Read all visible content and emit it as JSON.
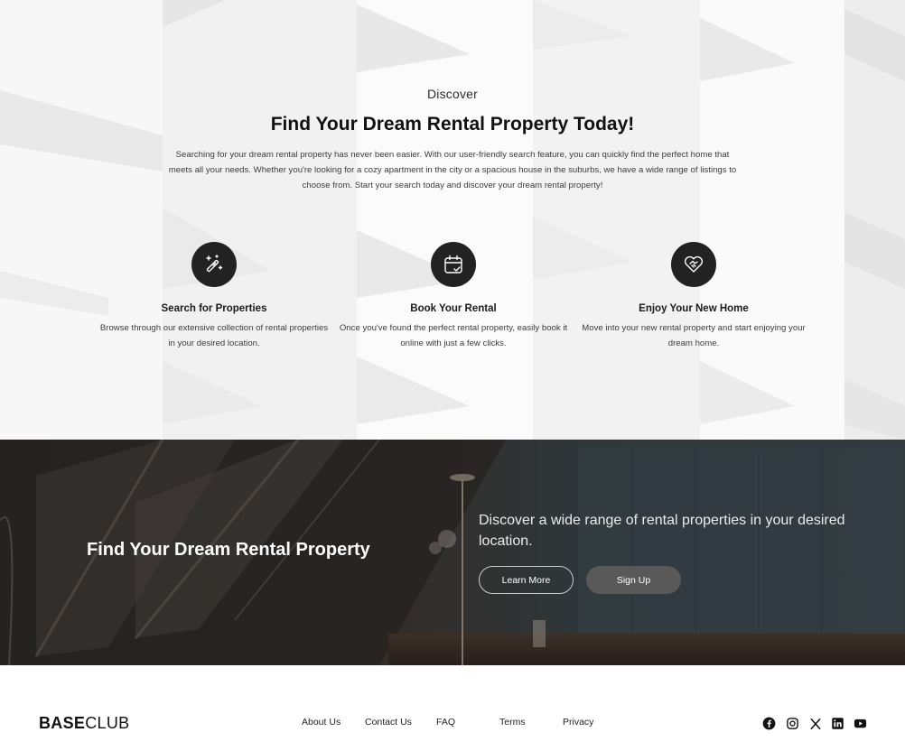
{
  "discover": {
    "eyebrow": "Discover",
    "headline": "Find Your Dream Rental Property Today!",
    "intro": "Searching for your dream rental property has never been easier. With our user-friendly search feature, you can quickly find the perfect home that meets all your needs. Whether you're looking for a cozy apartment in the city or a spacious house in the suburbs, we have a wide range of listings to choose from. Start your search today and discover your dream rental property!",
    "features": [
      {
        "icon": "magic-wand-icon",
        "title": "Search for Properties",
        "description": "Browse through our extensive collection of rental properties in your desired location."
      },
      {
        "icon": "calendar-check-icon",
        "title": "Book Your Rental",
        "description": "Once you've found the perfect rental property, easily book it online with just a few clicks."
      },
      {
        "icon": "heart-handshake-icon",
        "title": "Enjoy Your New Home",
        "description": "Move into your new rental property and start enjoying your dream home."
      }
    ]
  },
  "cta": {
    "title": "Find Your Dream Rental Property",
    "text": "Discover a wide range of rental properties in your desired location.",
    "learn_more": "Learn More",
    "sign_up": "Sign Up"
  },
  "footer": {
    "logo_bold": "BASE",
    "logo_light": "CLUB",
    "nav": [
      "About Us",
      "Contact Us",
      "FAQ",
      "Terms",
      "Privacy"
    ],
    "social": [
      "facebook-icon",
      "instagram-icon",
      "x-icon",
      "linkedin-icon",
      "youtube-icon"
    ]
  },
  "colors": {
    "icon_circle": "#222222",
    "cta_overlay": "#3a3532",
    "signup_button": "#595959"
  }
}
